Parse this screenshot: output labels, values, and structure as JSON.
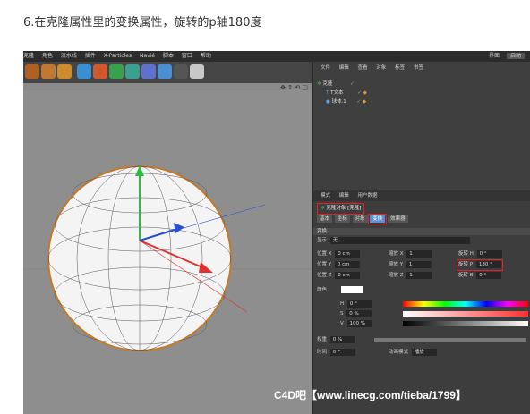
{
  "caption": "6.在克隆属性里的变换属性，旋转的p轴180度",
  "menubar": {
    "items": [
      "克隆",
      "角色",
      "流水线",
      "插件",
      "X-Particles",
      "Navié",
      "脚本",
      "窗口",
      "帮助"
    ],
    "right_label": "界面",
    "right_value": "启动"
  },
  "object_manager": {
    "menu": [
      "文件",
      "编辑",
      "查看",
      "对象",
      "标签",
      "书签"
    ],
    "rows": [
      {
        "name": "克隆"
      },
      {
        "name": "T文本"
      },
      {
        "name": "球体.1"
      }
    ]
  },
  "attribute_manager": {
    "menu": [
      "模式",
      "编辑",
      "用户数据"
    ],
    "object_title": "克隆对象 [克隆]",
    "tabs": [
      "基本",
      "坐标",
      "对象",
      "变换",
      "效果器"
    ],
    "active_tab": "变换",
    "section_title": "变换",
    "display_label": "显示",
    "display_value": "无",
    "position": {
      "label": "位置",
      "x": "0 cm",
      "y": "0 cm",
      "z": "0 cm"
    },
    "scale": {
      "label": "缩放",
      "x": "1",
      "y": "1",
      "z": "1"
    },
    "rotation": {
      "label": "旋转",
      "h": "0 °",
      "p": "180 °",
      "b": "0 °"
    },
    "color_label": "颜色",
    "h_label": "H",
    "h_value": "0 °",
    "s_label": "S",
    "s_value": "0 %",
    "v_label": "V",
    "v_value": "100 %",
    "weight_label": "权重",
    "weight_value": "0 %",
    "time_label": "时间",
    "time_value": "0 F",
    "anim_label": "动画模式",
    "anim_value": "播放"
  },
  "watermark": "C4D吧【www.linecg.com/tieba/1799】",
  "colors": {
    "accent_red": "#e0202a",
    "tab_blue": "#5b8fcf",
    "panel_bg": "#3d3d3d",
    "viewport_bg": "#8e8e8e"
  }
}
